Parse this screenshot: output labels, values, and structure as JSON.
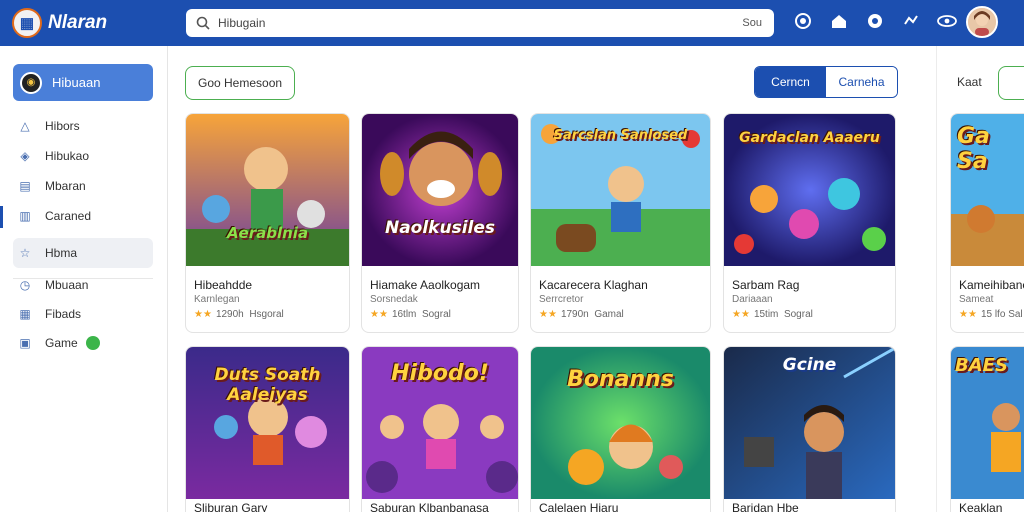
{
  "header": {
    "logo_text": "Nlaran",
    "search_value": "Hibugain",
    "search_button": "Sou",
    "badges": [
      "",
      "",
      ""
    ]
  },
  "sidebar": {
    "home_label": "Hibuaan",
    "items": [
      {
        "label": "Hibors",
        "icon": "triangle-icon"
      },
      {
        "label": "Hibukao",
        "icon": "compass-icon"
      },
      {
        "label": "Mbaran",
        "icon": "flag-icon"
      },
      {
        "label": "Caraned",
        "icon": "book-icon"
      },
      {
        "label": "Hbma",
        "icon": "star-icon"
      },
      {
        "label": "Mbuaan",
        "icon": "clock-icon"
      },
      {
        "label": "Fibads",
        "icon": "grid-icon"
      },
      {
        "label": "Game",
        "icon": "gamepad-icon"
      }
    ]
  },
  "main": {
    "filter_chip": "Goo Hemesoon",
    "segment": {
      "left": "Cerncn",
      "right": "Carneha"
    },
    "right_label": "Kaat",
    "cards": [
      {
        "art": "Aerablnia",
        "title": "Hibeahdde",
        "sub": "Karnlegan",
        "rating": "1290h",
        "cat": "Hsgoral"
      },
      {
        "art": "Naolkusiles",
        "title": "Hiamake Aaolkogam",
        "sub": "Sorsnedak",
        "rating": "16tlm",
        "cat": "Sogral"
      },
      {
        "art": "Sarcslan Sanlosed",
        "title": "Kacarecera Klaghan",
        "sub": "Serrcretor",
        "rating": "1790n",
        "cat": "Gamal"
      },
      {
        "art": "Gardaclan Aaaeru",
        "title": "Sarbam Rag",
        "sub": "Dariaaan",
        "rating": "15tim",
        "cat": "Sogral"
      },
      {
        "art": "Ga Sa",
        "title": "Kameihibane",
        "sub": "Sameat",
        "rating": "15 lfo",
        "cat": "Sal"
      },
      {
        "art": "Duts Soath Aaleiyas",
        "title": "Sliburan Gary",
        "sub": "",
        "rating": "",
        "cat": ""
      },
      {
        "art": "Hibodo!",
        "title": "Saburan Klbanbanasa",
        "sub": "",
        "rating": "",
        "cat": ""
      },
      {
        "art": "Bonanns",
        "title": "Calelaen Hiaru",
        "sub": "",
        "rating": "",
        "cat": ""
      },
      {
        "art": "Gcine",
        "title": "Baridan Hbe",
        "sub": "",
        "rating": "",
        "cat": ""
      },
      {
        "art": "BAES",
        "title": "Keaklan",
        "sub": "",
        "rating": "",
        "cat": ""
      }
    ]
  },
  "colors": {
    "header_bg": "#1c4fb0",
    "sidebar_active": "#4a7fd9",
    "chip_border": "#4caf50",
    "star": "#f5a623"
  }
}
